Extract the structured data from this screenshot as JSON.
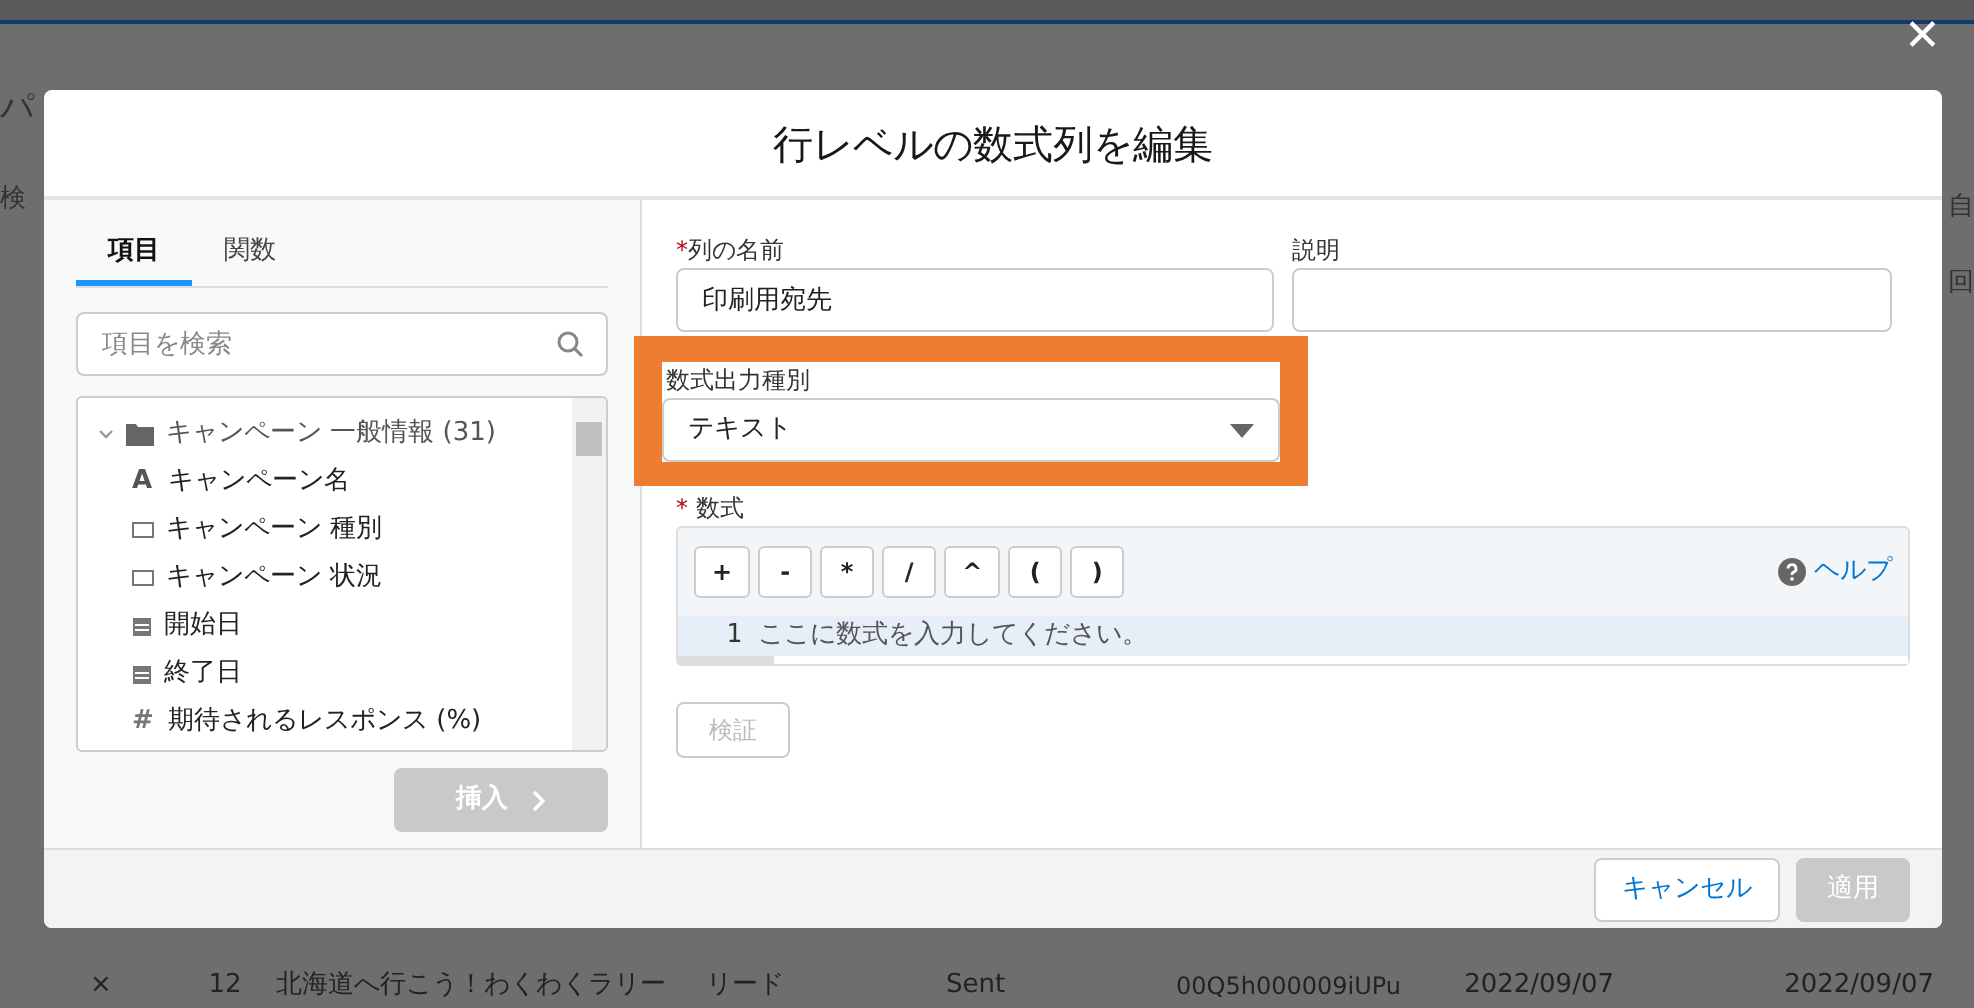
{
  "background": {
    "left_texts": [
      "パ",
      "検"
    ],
    "right_texts": [
      "自",
      "回"
    ],
    "bottom_row": {
      "close": "×",
      "cells": [
        "12",
        "北海道へ行こう！わくわくラリー",
        "リード",
        "Sent",
        "00Q5h000009iUPu",
        "2022/09/07",
        "2022/09/07"
      ]
    }
  },
  "dialog": {
    "title": "行レベルの数式列を編集",
    "close": "✕",
    "left": {
      "tabs": [
        {
          "label": "項目",
          "selected": true
        },
        {
          "label": "関数",
          "selected": false
        }
      ],
      "search": {
        "placeholder": "項目を検索"
      },
      "tree": [
        {
          "label": "キャンペーン 一般情報 (31)",
          "expanded": true,
          "children": [
            {
              "label": "キャンペーン名",
              "kind": "text",
              "icon": "A"
            },
            {
              "label": "キャンペーン 種別",
              "kind": "picklist"
            },
            {
              "label": "キャンペーン 状況",
              "kind": "picklist"
            },
            {
              "label": "開始日",
              "kind": "date"
            },
            {
              "label": "終了日",
              "kind": "date"
            },
            {
              "label": "期待されるレスポンス (%)",
              "kind": "number",
              "icon": "#"
            }
          ]
        }
      ],
      "insert_button": {
        "label": "挿入",
        "disabled": true
      }
    },
    "right": {
      "name_field": {
        "label": "列の名前",
        "required": true,
        "value": "印刷用宛先"
      },
      "description_field": {
        "label": "説明",
        "required": false
      },
      "output_type": {
        "label": "数式出力種別",
        "value": "テキスト",
        "highlighted": true
      },
      "formula": {
        "label": "数式",
        "required": true,
        "operators": [
          "+",
          "-",
          "*",
          "/",
          "^",
          "(",
          ")"
        ],
        "help": "ヘルプ",
        "line_number": "1",
        "placeholder": "ここに数式を入力してください。"
      },
      "verify_button": {
        "label": "検証",
        "disabled": true
      }
    },
    "footer": {
      "cancel": "キャンセル",
      "apply": {
        "label": "適用",
        "disabled": true
      }
    }
  }
}
